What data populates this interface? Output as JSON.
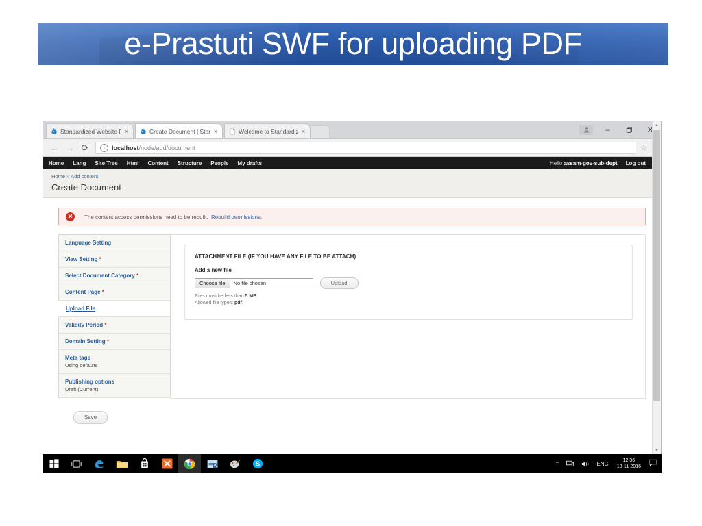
{
  "slide": {
    "title": "e-Prastuti SWF for uploading PDF",
    "banner_color": "#2f61b4"
  },
  "browser": {
    "tabs": [
      {
        "label": "Standardized Website Fr",
        "favicon": "drupal-favicon",
        "close": "×",
        "active": false
      },
      {
        "label": "Create Document | Stan",
        "favicon": "drupal-favicon",
        "close": "×",
        "active": true
      },
      {
        "label": "Welcome to Standardize",
        "favicon": "page-favicon",
        "close": "×",
        "active": false
      }
    ],
    "new_tab_label": "",
    "window_controls": {
      "profile": "■",
      "minimize": "–",
      "maximize": "❐",
      "close": "✕"
    },
    "omnibox": {
      "back": "←",
      "forward": "→",
      "reload": "⟳",
      "info_icon": "ⓘ",
      "url_host": "localhost",
      "url_path": "/node/add/document",
      "star": "☆",
      "menu": "⋮"
    },
    "scrollbar": {
      "up": "▲",
      "down": "▼"
    }
  },
  "admin_bar": {
    "links": [
      "Home",
      "Lang",
      "Site Tree",
      "Html",
      "Content",
      "Structure",
      "People",
      "My drafts"
    ],
    "hello_prefix": "Hello",
    "username": "assam-gov-sub-dept",
    "logout": "Log out"
  },
  "page": {
    "breadcrumb": {
      "home": "Home",
      "separator": "»",
      "current": "Add content"
    },
    "title": "Create Document"
  },
  "message": {
    "icon": "✕",
    "text": "The content access permissions need to be rebuilt.",
    "link": "Rebuild permissions.",
    "type": "error",
    "bg_color": "#fcf0ee",
    "border_color": "#e8a799",
    "icon_color": "#cf2f25"
  },
  "vertical_tabs": [
    {
      "title": "Language Setting",
      "required": "",
      "sub": "",
      "selected": false
    },
    {
      "title": "View Setting",
      "required": "*",
      "sub": "",
      "selected": false
    },
    {
      "title": "Select Document Category",
      "required": "*",
      "sub": "",
      "selected": false
    },
    {
      "title": "Content Page",
      "required": "*",
      "sub": "",
      "selected": false
    },
    {
      "title": "Upload File",
      "required": "",
      "sub": "",
      "selected": true
    },
    {
      "title": "Validity Period",
      "required": "*",
      "sub": "",
      "selected": false
    },
    {
      "title": "Domain Setting",
      "required": "*",
      "sub": "",
      "selected": false
    },
    {
      "title": "Meta tags",
      "required": "",
      "sub": "Using defaults",
      "selected": false
    },
    {
      "title": "Publishing options",
      "required": "",
      "sub": "Draft (Current)",
      "selected": false
    }
  ],
  "panel": {
    "legend": "ATTACHMENT FILE (IF YOU HAVE ANY FILE TO BE ATTACH)",
    "field_label": "Add a new file",
    "choose_file_label": "Choose file",
    "file_name_value": "No file chosen",
    "upload_label": "Upload",
    "help_size_prefix": "Files must be less than ",
    "help_size_value": "5 MB",
    "help_size_suffix": ".",
    "help_types_prefix": "Allowed file types: ",
    "help_types_value": "pdf",
    "help_types_suffix": "."
  },
  "actions": {
    "save_label": "Save"
  },
  "taskbar": {
    "icons": [
      {
        "name": "start-button",
        "glyph": "⊞",
        "color": "#ffffff",
        "running": false
      },
      {
        "name": "task-view-button",
        "glyph": "⎕",
        "color": "#ffffff",
        "running": false
      },
      {
        "name": "edge-browser-icon",
        "glyph": "e",
        "color": "#1b8fd4",
        "running": false
      },
      {
        "name": "file-explorer-icon",
        "glyph": "▰",
        "color": "#f5b93d",
        "running": false
      },
      {
        "name": "microsoft-store-icon",
        "glyph": "▣",
        "color": "#ffffff",
        "running": false
      },
      {
        "name": "xampp-icon",
        "glyph": "✖",
        "color": "#ffffff",
        "running": false
      },
      {
        "name": "chrome-browser-icon",
        "glyph": "◉",
        "color": "#4285f4",
        "running": true
      },
      {
        "name": "word-document-icon",
        "glyph": "▤",
        "color": "#b8d6ef",
        "running": false
      },
      {
        "name": "paint-icon",
        "glyph": "✒",
        "color": "#d8d8d8",
        "running": false
      },
      {
        "name": "skype-icon",
        "glyph": "S",
        "color": "#ffffff",
        "running": false
      }
    ],
    "tray": {
      "chevron": "⌃",
      "network": "⌨",
      "volume": "↯",
      "language": "ENG",
      "time": "12:36",
      "date": "18-11-2016",
      "notifications": "▭"
    }
  }
}
